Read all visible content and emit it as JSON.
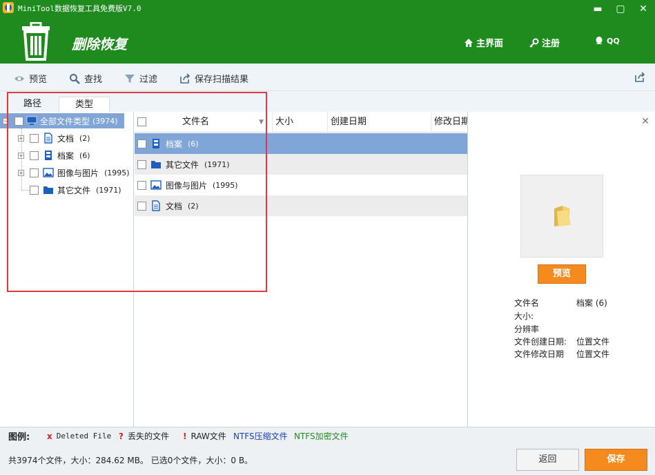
{
  "window": {
    "title": "MiniTool数据恢复工具免费版V7.0",
    "minimize": "▬",
    "maximize": "▢",
    "close": "✕"
  },
  "header": {
    "page_title": "删除恢复",
    "nav": [
      {
        "label": "主界面",
        "icon": "home-icon"
      },
      {
        "label": "注册",
        "icon": "key-icon"
      },
      {
        "label": "QQ",
        "icon": "qq-icon"
      }
    ]
  },
  "toolbar": {
    "preview": "预览",
    "find": "查找",
    "filter": "过滤",
    "save_scan": "保存扫描结果"
  },
  "tabs": {
    "path": "路径",
    "type": "类型",
    "active": "类型"
  },
  "tree": {
    "root": {
      "label": "全部文件类型",
      "count": "(3974)"
    },
    "items": [
      {
        "label": "文档",
        "count": "(2)",
        "icon": "document-icon"
      },
      {
        "label": "档案",
        "count": "(6)",
        "icon": "archive-icon"
      },
      {
        "label": "图像与图片",
        "count": "(1995)",
        "icon": "image-icon"
      },
      {
        "label": "其它文件",
        "count": "(1971)",
        "icon": "folder-icon"
      }
    ]
  },
  "list": {
    "columns": [
      "文件名",
      "大小",
      "创建日期",
      "修改日期"
    ],
    "rows": [
      {
        "name": "档案",
        "count": "(6)",
        "icon": "archive-icon",
        "selected": true
      },
      {
        "name": "其它文件",
        "count": "(1971)",
        "icon": "folder-icon"
      },
      {
        "name": "图像与图片",
        "count": "(1995)",
        "icon": "image-icon"
      },
      {
        "name": "文档",
        "count": "(2)",
        "icon": "document-icon"
      }
    ]
  },
  "preview": {
    "button": "预览",
    "info": [
      {
        "label": "文件名",
        "value": "档案 (6)"
      },
      {
        "label": "大小:",
        "value": ""
      },
      {
        "label": "分辨率",
        "value": ""
      },
      {
        "label": "文件创建日期:",
        "value": "位置文件"
      },
      {
        "label": "文件修改日期",
        "value": "位置文件"
      }
    ]
  },
  "legend": {
    "title": "图例:",
    "items": [
      {
        "mark": "x",
        "label": "Deleted File",
        "color": "#d21f1f"
      },
      {
        "mark": "?",
        "label": "丢失的文件",
        "color": "#d21f1f"
      },
      {
        "mark": "!",
        "label": "RAW文件",
        "color": "#d21f1f"
      },
      {
        "mark": "",
        "label": "NTFS压缩文件",
        "color": "#1a3fb8"
      },
      {
        "mark": "",
        "label": "NTFS加密文件",
        "color": "#1f8b1f"
      }
    ]
  },
  "status": {
    "summary": "共3974个文件，大小：284.62 MB。 已选0个文件，大小：0 B。",
    "back": "返回",
    "save": "保存"
  },
  "colors": {
    "header_green": "#1f8b1f",
    "accent_orange": "#f58a1f",
    "selection_blue": "#7fa6d6",
    "highlight_red": "#e0393b"
  }
}
